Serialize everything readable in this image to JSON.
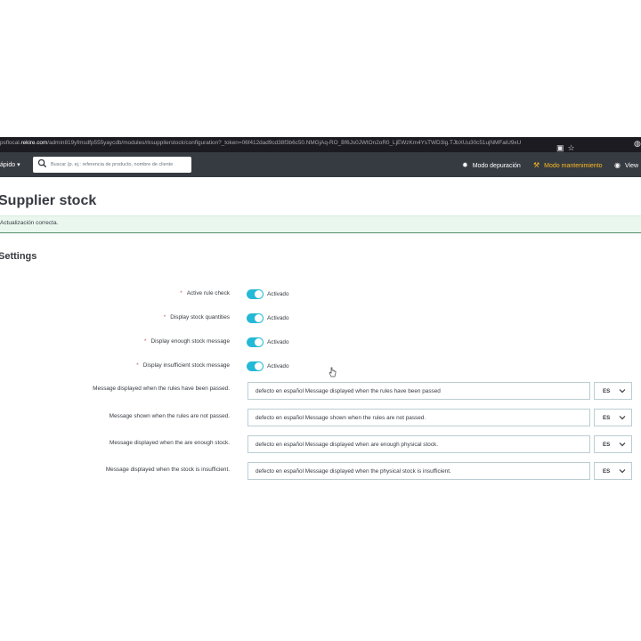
{
  "browser": {
    "url_prefix": "psflocal.",
    "url_host": "rekire.com",
    "url_path": "/admin819yfmsdfp555yaycdb/modules/rksupplierstock/configuration?_token=06f412dad9cd38f3b6c50.NMGjAq-RO_Bf6Js0JWtOn2oR0_LjEWzKm4YsTWD3ig.TJbXUu30c51ujNMFaiU9xU"
  },
  "header": {
    "quick_access_label": "ápido",
    "search_placeholder": "Buscar (p. ej.: referencia de producto, nombre de cliente",
    "debug_mode_label": "Modo depuración",
    "maintenance_mode_label": "Modo mantenimiento",
    "view_label": "View",
    "maintenance_color": "#fbbb22"
  },
  "page": {
    "title": "Supplier stock",
    "alert_success": "Actualización correcta.",
    "section_title": "Settings"
  },
  "toggles": [
    {
      "label": "Active rule check",
      "required": true,
      "state_label": "Activado",
      "on": true
    },
    {
      "label": "Display stock quantities",
      "required": true,
      "state_label": "Activado",
      "on": true
    },
    {
      "label": "Display enough stock message",
      "required": true,
      "state_label": "Activado",
      "on": true
    },
    {
      "label": "Display insufficient stock message",
      "required": true,
      "state_label": "Activado",
      "on": true
    }
  ],
  "messages": [
    {
      "label": "Message displayed when the rules have been passed.",
      "value": "defecto en español Message displayed when the rules have been passed",
      "lang": "ES"
    },
    {
      "label": "Message shown when the rules are not passed.",
      "value": "defecto en español Message shown when the rules are not passed.",
      "lang": "ES"
    },
    {
      "label": "Message displayed when the are enough stock.",
      "value": "defecto en español Message displayed when are enough physical stock.",
      "lang": "ES"
    },
    {
      "label": "Message displayed when the stock is insufficient.",
      "value": "defecto en español Message displayed when the physical stock is insufficient.",
      "lang": "ES"
    }
  ],
  "required_marker": "*",
  "colors": {
    "toggle_on": "#25b9d7",
    "header_bg": "#363a41",
    "alert_bg": "#eaf7ef"
  }
}
